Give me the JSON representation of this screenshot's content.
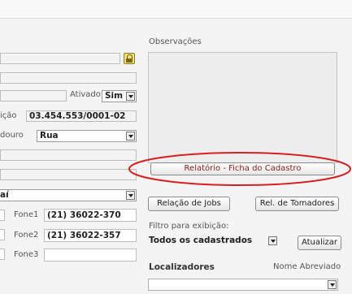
{
  "observacoes": {
    "label": "Observações",
    "value": ""
  },
  "ativado": {
    "label": "Ativado",
    "value": "Sim"
  },
  "inscricao": {
    "label_fragment": "ição",
    "value": "03.454.553/0001-02"
  },
  "logradouro": {
    "label_fragment": "douro",
    "value": "Rua"
  },
  "estado": {
    "value_fragment": "aí"
  },
  "fones": [
    {
      "label": "Fone1",
      "value": "(21) 36022-370"
    },
    {
      "label": "Fone2",
      "value": "(21) 36022-357"
    },
    {
      "label": "Fone3",
      "value": ""
    }
  ],
  "buttons": {
    "relatorio": "Relatório - Ficha do Cadastro",
    "relacao_jobs": "Relação de Jobs",
    "rel_tomadores": "Rel. de Tomadores",
    "atualizar": "Atualizar"
  },
  "filtro": {
    "label": "Filtro para exibição:",
    "value": "Todos os cadastrados"
  },
  "localizadores": {
    "label": "Localizadores",
    "nome_abreviado_label": "Nome Abreviado",
    "value": ""
  },
  "colors": {
    "highlight_ellipse": "#d42020",
    "relatorio_text": "#8b1a1a"
  },
  "icons": {
    "lock": "padlock-icon",
    "dropdown": "chevron-down-icon"
  }
}
